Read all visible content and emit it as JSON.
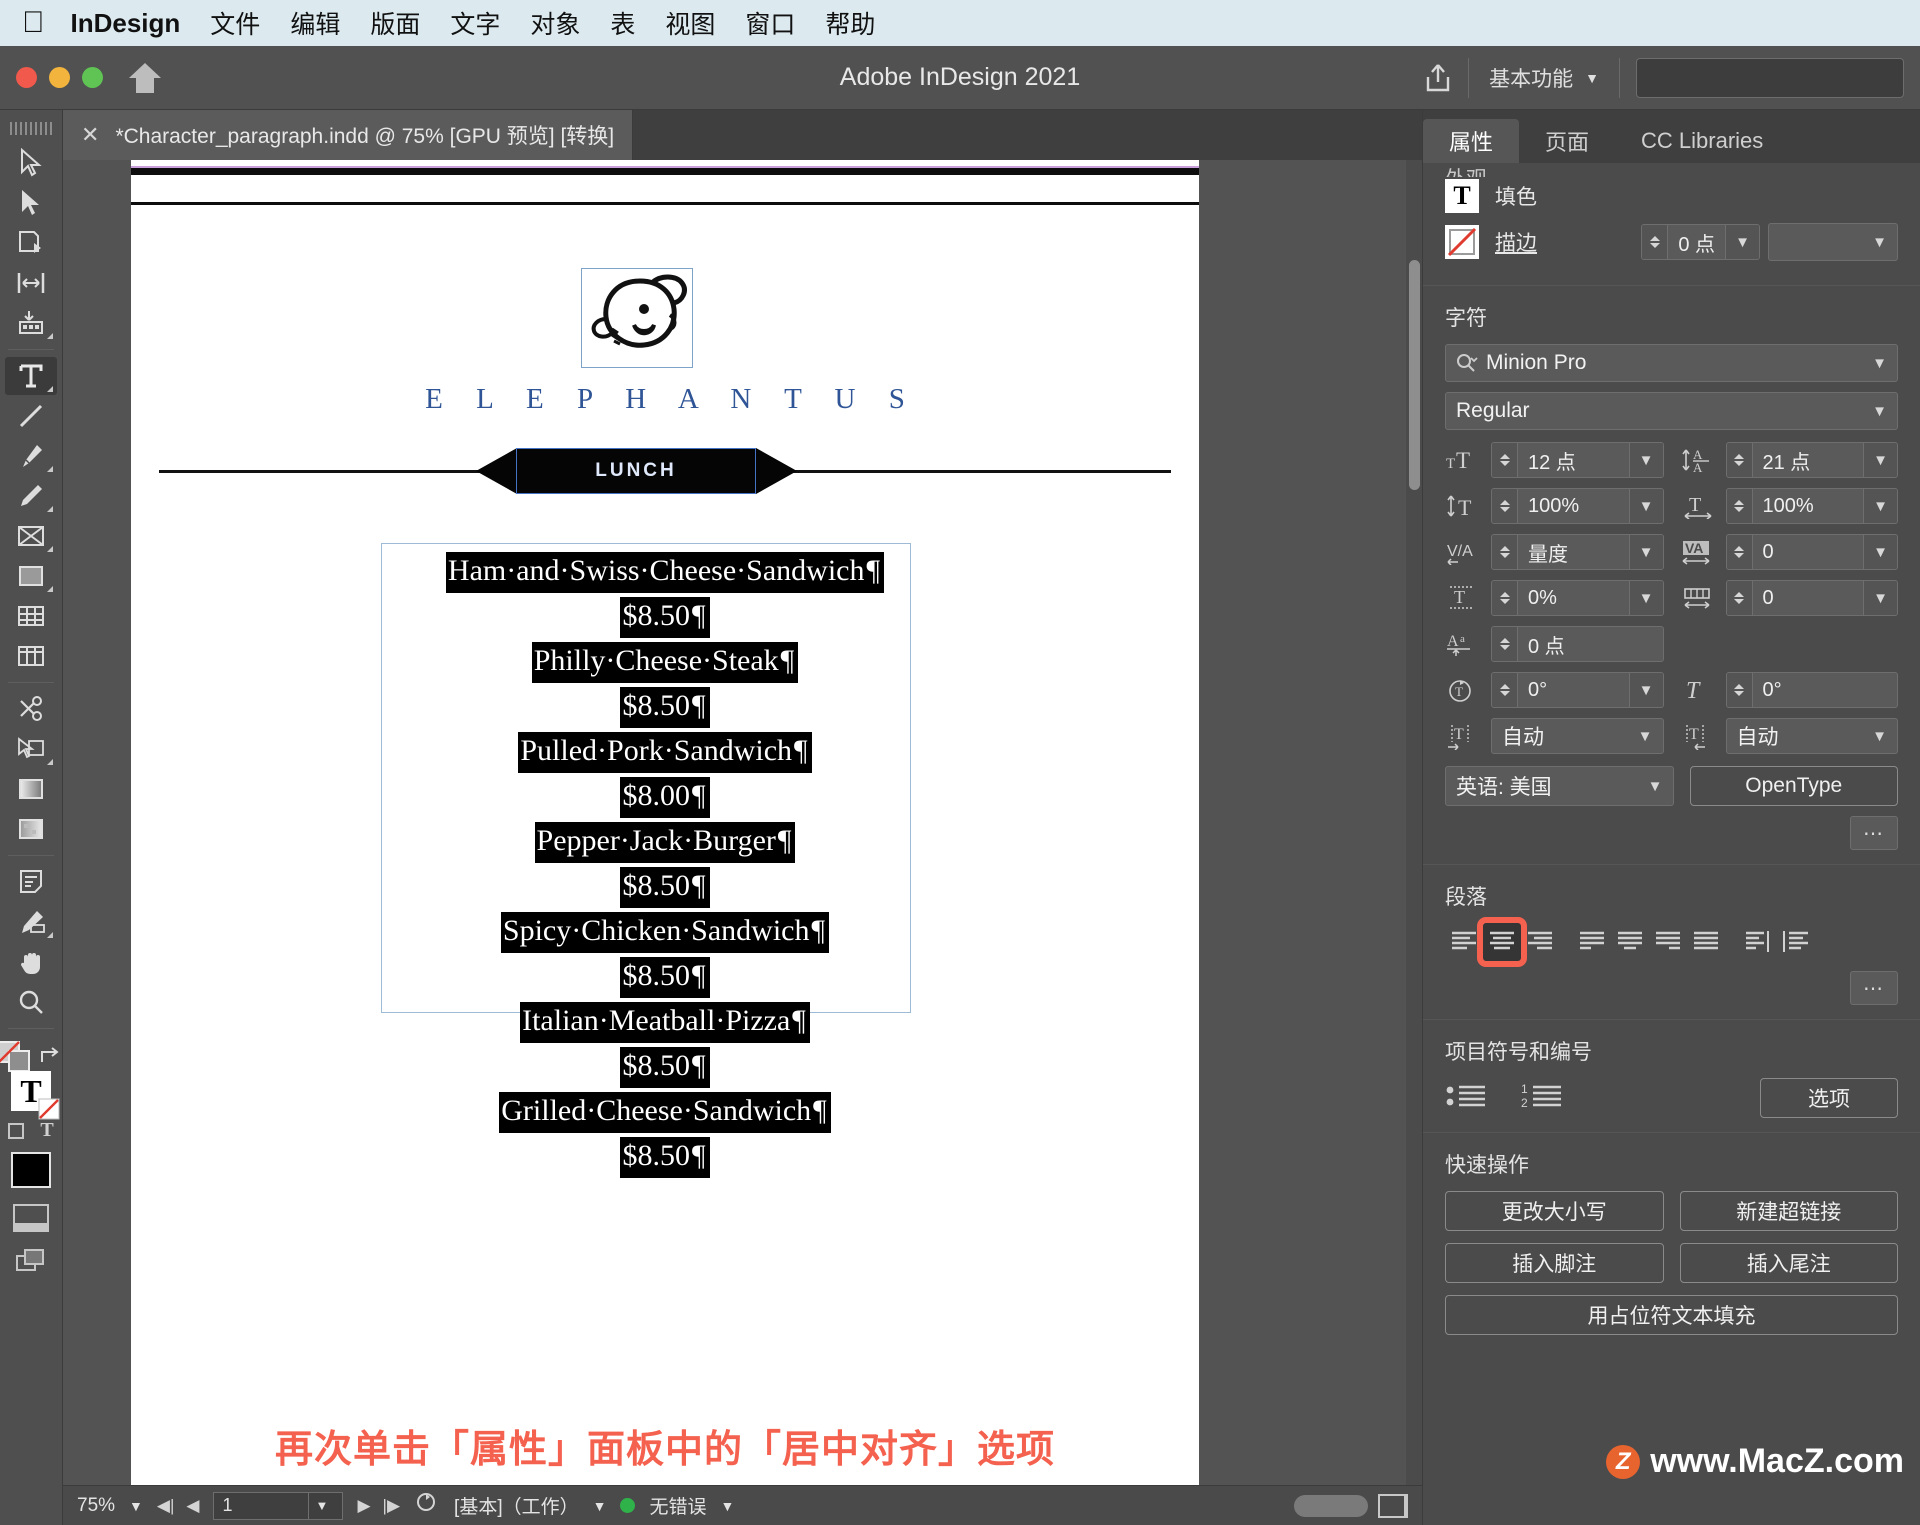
{
  "mac_menu": {
    "apple_icon": "apple-icon",
    "app": "InDesign",
    "items": [
      "文件",
      "编辑",
      "版面",
      "文字",
      "对象",
      "表",
      "视图",
      "窗口",
      "帮助"
    ]
  },
  "titlebar": {
    "title": "Adobe InDesign 2021",
    "home_icon": "home-icon",
    "share_icon": "share-icon",
    "workspace": "基本功能",
    "search_placeholder": ""
  },
  "doctab": {
    "close_icon": "close-icon",
    "label": "*Character_paragraph.indd @ 75% [GPU 预览] [转换]"
  },
  "toolbar": {
    "tools": [
      {
        "name": "selection-tool"
      },
      {
        "name": "direct-selection-tool"
      },
      {
        "name": "page-tool"
      },
      {
        "name": "gap-tool"
      },
      {
        "name": "content-collector-tool"
      },
      {
        "name": "type-tool",
        "active": true
      },
      {
        "name": "line-tool"
      },
      {
        "name": "pen-tool"
      },
      {
        "name": "pencil-tool"
      },
      {
        "name": "frame-tool"
      },
      {
        "name": "rectangle-tool"
      },
      {
        "name": "table-tool"
      },
      {
        "name": "column-tool"
      },
      {
        "name": "scissors-tool"
      },
      {
        "name": "free-transform-tool"
      },
      {
        "name": "gradient-swatch-tool"
      },
      {
        "name": "gradient-feather-tool"
      },
      {
        "name": "note-tool"
      },
      {
        "name": "eyedropper-tool"
      },
      {
        "name": "hand-tool"
      },
      {
        "name": "zoom-tool"
      }
    ]
  },
  "document": {
    "brand": "E L E P H A N T U S",
    "banner": "LUNCH",
    "logo_icon": "elephant-logo-icon",
    "menu_lines": [
      "Ham·and·Swiss·Cheese·Sandwich",
      "$8.50",
      "Philly·Cheese·Steak",
      "$8.50",
      "Pulled·Pork·Sandwich",
      "$8.00",
      "Pepper·Jack·Burger",
      "$8.50",
      "Spicy·Chicken·Sandwich",
      "$8.50",
      "Italian·Meatball·Pizza",
      "$8.50",
      "Grilled·Cheese·Sandwich",
      "$8.50"
    ],
    "annotation": "再次单击「属性」面板中的「居中对齐」选项"
  },
  "panel": {
    "tabs": [
      {
        "label": "属性",
        "active": true
      },
      {
        "label": "页面",
        "active": false
      },
      {
        "label": "CC Libraries",
        "active": false
      }
    ],
    "appearance": {
      "clipped_title": "外观",
      "fill_label": "填色",
      "fill_icon": "text-fill-swatch-icon",
      "stroke_label": "描边",
      "stroke_icon": "none-swatch-icon",
      "stroke_weight": "0 点"
    },
    "character": {
      "title": "字符",
      "font_family": "Minion Pro",
      "font_search_icon": "search-icon",
      "font_style": "Regular",
      "font_size": {
        "icon": "font-size-icon",
        "value": "12 点"
      },
      "leading": {
        "icon": "leading-icon",
        "value": "21 点"
      },
      "vertical_scale": {
        "icon": "vertical-scale-icon",
        "value": "100%"
      },
      "horizontal_scale": {
        "icon": "horizontal-scale-icon",
        "value": "100%"
      },
      "kerning": {
        "icon": "kerning-icon",
        "value": "量度"
      },
      "tracking": {
        "icon": "tracking-icon",
        "value": "0"
      },
      "baseline_shift_pct": {
        "icon": "baseline-shift-icon",
        "value": "0%"
      },
      "tsume": {
        "icon": "tsume-icon",
        "value": "0"
      },
      "baseline_shift": {
        "icon": "baseline-offset-icon",
        "value": "0 点"
      },
      "char_rotation": {
        "icon": "character-rotation-icon",
        "value": "0°"
      },
      "skew": {
        "icon": "skew-icon",
        "value": "0°"
      },
      "left_aki": {
        "icon": "left-aki-icon",
        "value": "自动"
      },
      "right_aki": {
        "icon": "right-aki-icon",
        "value": "自动"
      },
      "language": "英语: 美国",
      "opentype_label": "OpenType",
      "more_icon": "more-options-icon"
    },
    "paragraph": {
      "title": "段落",
      "align_buttons": [
        {
          "name": "align-left",
          "selected": false
        },
        {
          "name": "align-center",
          "selected": true
        },
        {
          "name": "align-right",
          "selected": false
        },
        {
          "name": "justify-last-left",
          "selected": false
        },
        {
          "name": "justify-last-center",
          "selected": false
        },
        {
          "name": "justify-last-right",
          "selected": false
        },
        {
          "name": "justify-all",
          "selected": false
        },
        {
          "name": "align-toward-spine",
          "selected": false
        },
        {
          "name": "align-away-spine",
          "selected": false
        }
      ],
      "more_icon": "more-options-icon"
    },
    "bullets": {
      "title": "项目符号和编号",
      "bullet_icon": "bulleted-list-icon",
      "number_icon": "numbered-list-icon",
      "options_label": "选项"
    },
    "quick_actions": {
      "title": "快速操作",
      "buttons": [
        "更改大小写",
        "新建超链接",
        "插入脚注",
        "插入尾注",
        "用占位符文本填充"
      ]
    }
  },
  "statusbar": {
    "zoom": "75%",
    "first_icon": "first-page-icon",
    "prev_icon": "previous-page-icon",
    "page": "1",
    "next_icon": "next-page-icon",
    "last_icon": "last-page-icon",
    "preflight_icon": "preflight-icon",
    "preset": "[基本]（工作）",
    "error_status": "无错误"
  },
  "watermark": {
    "text": "www.MacZ.com",
    "logo": "z-logo-icon"
  }
}
